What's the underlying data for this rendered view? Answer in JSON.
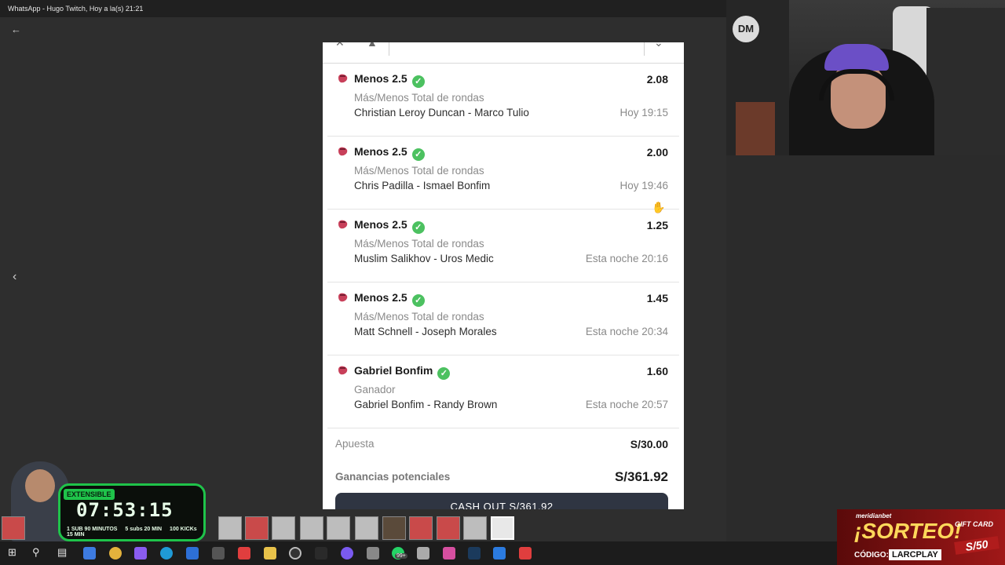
{
  "window": {
    "title": "WhatsApp - Hugo Twitch, Hoy a la(s) 21:21"
  },
  "viewer": {
    "back_icon": "arrow-left-icon",
    "prev_icon": "chevron-left-icon"
  },
  "bet_slip": {
    "selections": [
      {
        "market": "Menos 2.5",
        "odds": "2.08",
        "type": "Más/Menos Total de rondas",
        "match": "Christian Leroy Duncan - Marco Tulio",
        "time": "Hoy 19:15"
      },
      {
        "market": "Menos 2.5",
        "odds": "2.00",
        "type": "Más/Menos Total de rondas",
        "match": "Chris Padilla - Ismael Bonfim",
        "time": "Hoy 19:46"
      },
      {
        "market": "Menos 2.5",
        "odds": "1.25",
        "type": "Más/Menos Total de rondas",
        "match": "Muslim Salikhov - Uros Medic",
        "time": "Esta noche 20:16"
      },
      {
        "market": "Menos 2.5",
        "odds": "1.45",
        "type": "Más/Menos Total de rondas",
        "match": "Matt Schnell - Joseph Morales",
        "time": "Esta noche 20:34"
      },
      {
        "market": "Gabriel Bonfim",
        "odds": "1.60",
        "type": "Ganador",
        "match": "Gabriel Bonfim - Randy Brown",
        "time": "Esta noche 20:57"
      }
    ],
    "stake_label": "Apuesta",
    "stake_value": "S/30.00",
    "winnings_label": "Ganancias potenciales",
    "winnings_value": "S/361.92",
    "cashout_label": "CASH OUT  S/361.92",
    "check_glyph": "✓"
  },
  "webcam": {
    "logo_text": "DM"
  },
  "timer_widget": {
    "tag": "EXTENSIBLE",
    "clock": "07:53:15",
    "rate_sub": "1 SUB 90 MINUTOS",
    "rate_bits": "5 subs 20 MIN",
    "rate_kicks": "100 KICKs 15 MIN"
  },
  "promo": {
    "brand": "meridianbet",
    "headline": "¡SORTEO!",
    "code_label": "CÓDIGO:",
    "code": "LARCPLAY",
    "gift_label": "GIFT CARD",
    "gift_amount": "S/50"
  },
  "taskbar": {
    "badge": "99+"
  },
  "colors": {
    "check_green": "#4cc160",
    "timer_green": "#1fc34a",
    "cashout_bg": "#2f3542",
    "promo_red": "#a01818"
  }
}
